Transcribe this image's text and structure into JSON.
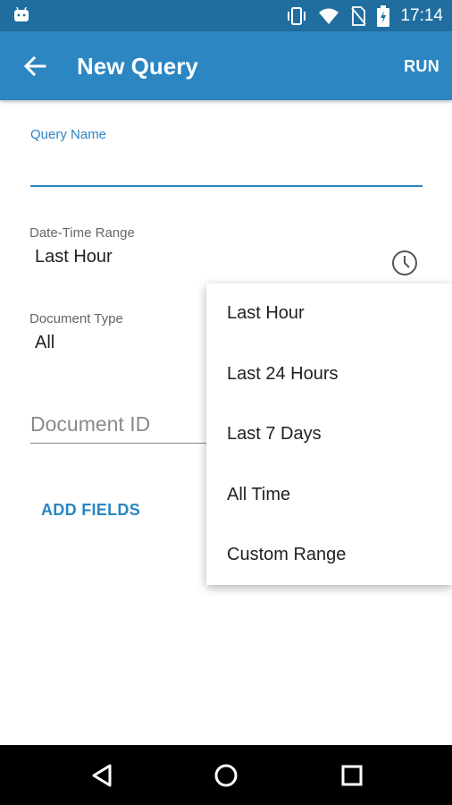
{
  "status_bar": {
    "time": "17:14",
    "icons": [
      "android-icon",
      "vibrate-icon",
      "wifi-icon",
      "no-sim-icon",
      "battery-charging-icon"
    ]
  },
  "app_bar": {
    "title": "New Query",
    "action": "RUN"
  },
  "form": {
    "query_name_label": "Query Name",
    "query_name_value": "",
    "datetime_label": "Date-Time Range",
    "datetime_value": "Last Hour",
    "doc_type_label": "Document Type",
    "doc_type_value": "All",
    "doc_id_placeholder": "Document ID",
    "add_fields_label": "ADD FIELDS"
  },
  "dropdown": {
    "items": [
      "Last Hour",
      "Last 24 Hours",
      "Last 7 Days",
      "All Time",
      "Custom Range"
    ]
  },
  "colors": {
    "app_bar": "#2b86c2",
    "status_bar": "#1f6e9f",
    "accent": "#2b86c2"
  }
}
